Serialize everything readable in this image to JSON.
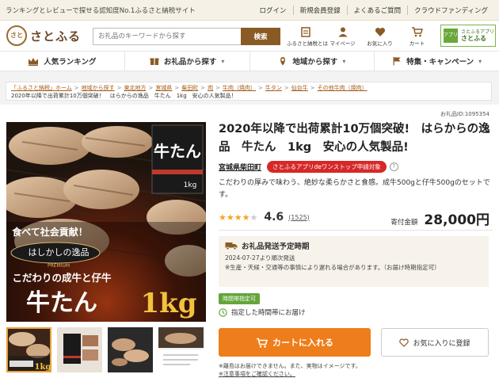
{
  "topbar": {
    "tagline": "ランキングとレビューで探せる認知度No.1ふるさと納税サイト",
    "links": [
      "ログイン",
      "新規会員登録",
      "よくあるご質問",
      "クラウドファンディング"
    ]
  },
  "header": {
    "logo_mark": "さと",
    "logo_text": "さとふる",
    "search_placeholder": "お礼品のキーワードから探す",
    "search_button": "検索",
    "icons": [
      {
        "label": "ふるさと納税とは",
        "icon": "furusato-icon"
      },
      {
        "label": "マイページ",
        "icon": "user-icon"
      },
      {
        "label": "お気に入り",
        "icon": "heart-icon"
      },
      {
        "label": "カート",
        "icon": "cart-icon"
      }
    ],
    "app_badge": {
      "mark": "アプリ",
      "line1": "さとふるアプリ",
      "line2": "さとふる"
    }
  },
  "nav": [
    {
      "label": "人気ランキング",
      "icon": "crown-icon"
    },
    {
      "label": "お礼品から探す",
      "icon": "gift-icon"
    },
    {
      "label": "地域から探す",
      "icon": "map-icon"
    },
    {
      "label": "特集・キャンペーン",
      "icon": "flag-icon"
    }
  ],
  "breadcrumb": {
    "links": [
      "「ふるさと納税」ホーム",
      "地域から探す",
      "東北地方",
      "宮城県",
      "柴田町",
      "肉",
      "牛肉（焼肉）",
      "牛タン",
      "仙台牛",
      "その他牛肉（焼肉）"
    ],
    "current": "2020年以降で出荷累計10万個突破！　はらからの逸品　牛たん　1kg　安心の人気製品！"
  },
  "product": {
    "item_no": "お礼品ID:1095354",
    "title": "2020年以降で出荷累計10万個突破!　はらからの逸品　牛たん　1kg　安心の人気製品!",
    "prefecture": "宮城県柴田町",
    "app_tag": "さとふるアプリdeワンストップ申請対象",
    "help": "?",
    "description": "こだわりの厚みで味わう、絶妙な柔らかさと食感。成牛500gと仔牛500gのセットです。",
    "rating": "4.6",
    "rating_value": 4.6,
    "reviews": "(1525)",
    "price_label": "寄付金額",
    "price": "28,000円"
  },
  "image_text": {
    "banner": "食べて社会貢献！",
    "brand": "はしかしの逸品",
    "premium": "PREMIUM",
    "catch": "こだわりの成牛と仔牛",
    "name": "牛たん",
    "amount": "1kg",
    "box_label": "牛たん",
    "box_amount": "1kg"
  },
  "shipping": {
    "heading": "お礼品発送予定時期",
    "date": "2024-07-27より順次発送",
    "note": "※生産・天候・交通等の事情により遅れる場合があります。（お届け時期指定可）"
  },
  "delivery": {
    "tag": "時間帯指定可",
    "option": "指定した時間帯にお届け"
  },
  "actions": {
    "cart": "カートに入れる",
    "favorite": "お気に入りに登録"
  },
  "notes": {
    "line1": "※離島はお届けできません。また、実物はイメージです。",
    "line2": "※注意事項をご確認ください。"
  },
  "colors": {
    "accent_brown": "#8a5a25",
    "cart_orange": "#ee7d1b",
    "tag_red": "#d62828",
    "tag_green": "#64a53b",
    "star": "#f2a61f"
  }
}
